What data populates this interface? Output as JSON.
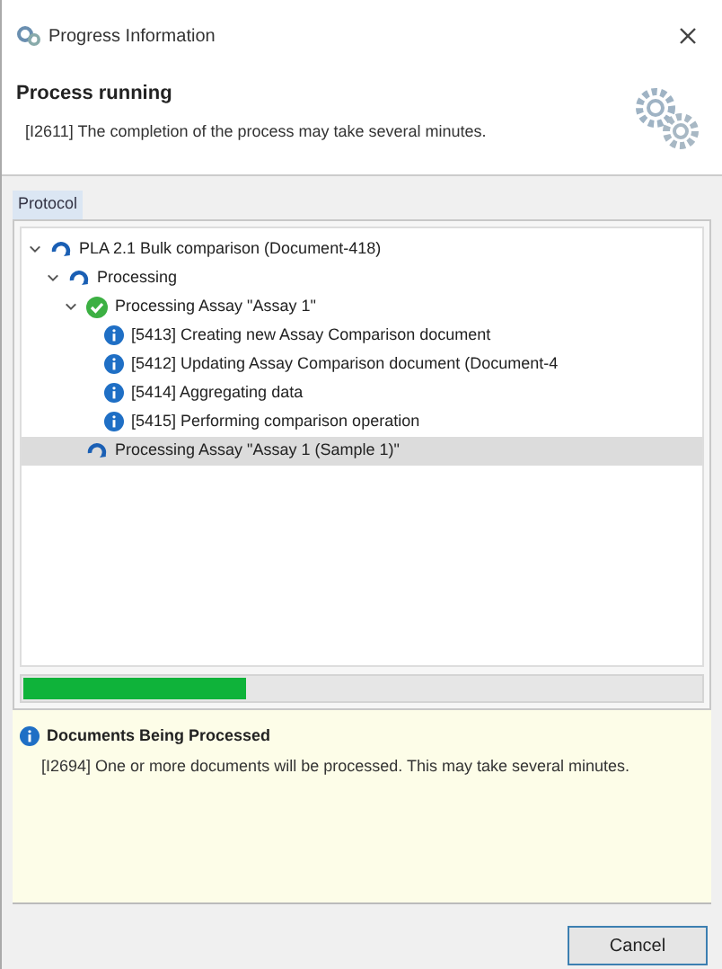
{
  "window": {
    "title": "Progress Information"
  },
  "header": {
    "title": "Process running",
    "message": "[I2611] The completion of the process may take several minutes."
  },
  "protocol_tab": {
    "label": "Protocol",
    "selected": true
  },
  "tree": [
    {
      "kind": "running",
      "label": "PLA 2.1 Bulk comparison (Document-418)",
      "expanded": true,
      "selected": false,
      "children": [
        {
          "kind": "running",
          "label": "Processing",
          "expanded": true,
          "selected": false,
          "children": [
            {
              "kind": "done",
              "label": "Processing Assay \"Assay 1\"",
              "expanded": true,
              "selected": false,
              "children": [
                {
                  "kind": "info",
                  "label": "[5413] Creating new Assay Comparison document",
                  "selected": false
                },
                {
                  "kind": "info",
                  "label": "[5412] Updating Assay Comparison document (Document-4",
                  "selected": false
                },
                {
                  "kind": "info",
                  "label": "[5414] Aggregating data",
                  "selected": false
                },
                {
                  "kind": "info",
                  "label": "[5415] Performing comparison operation",
                  "selected": false
                }
              ]
            },
            {
              "kind": "running",
              "label": "Processing Assay \"Assay 1 (Sample 1)\"",
              "selected": true
            }
          ]
        }
      ]
    }
  ],
  "progress": {
    "level": 0.33
  },
  "message": {
    "title": "Documents Being Processed",
    "text": "[I2694] One or more documents will be processed. This may take several minutes."
  },
  "buttons": [
    {
      "label": "Cancel"
    }
  ]
}
